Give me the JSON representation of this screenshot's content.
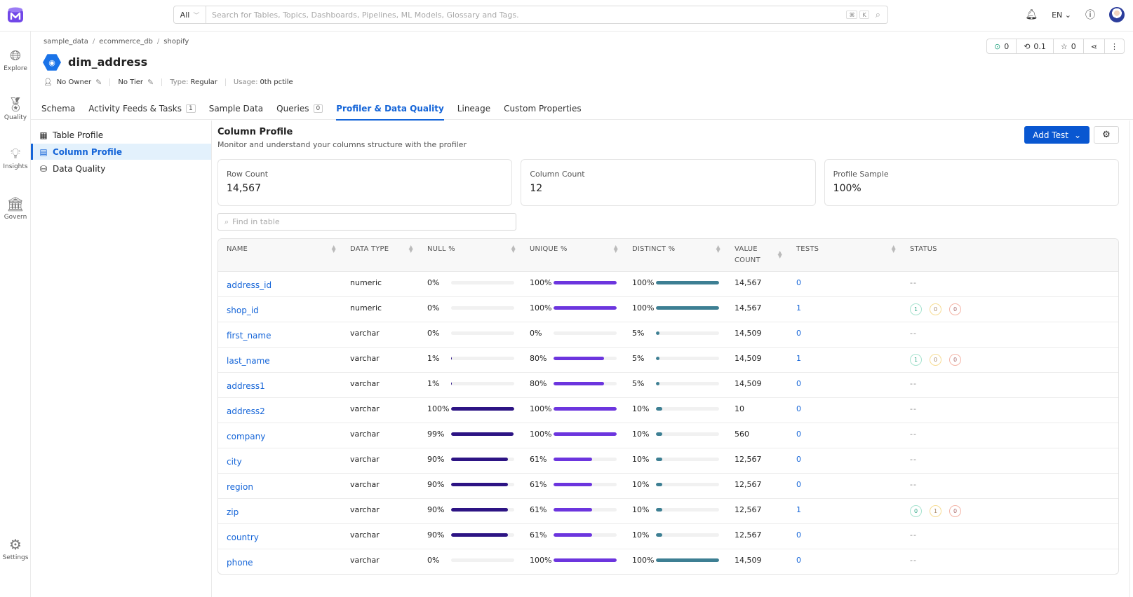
{
  "topbar": {
    "search_scope": "All",
    "search_placeholder": "Search for Tables, Topics, Dashboards, Pipelines, ML Models, Glossary and Tags.",
    "kbd_keys": [
      "⌘",
      "K"
    ],
    "language": "EN"
  },
  "leftnav": {
    "items": [
      {
        "label": "Explore",
        "icon": "globe-search-icon"
      },
      {
        "label": "Quality",
        "icon": "award-icon"
      },
      {
        "label": "Insights",
        "icon": "lightbulb-icon"
      },
      {
        "label": "Govern",
        "icon": "bank-icon"
      },
      {
        "label": "Settings",
        "icon": "sliders-icon"
      }
    ]
  },
  "breadcrumb": [
    "sample_data",
    "ecommerce_db",
    "shopify"
  ],
  "entity": {
    "title": "dim_address",
    "owner": "No Owner",
    "tier": "No Tier",
    "type_label": "Type:",
    "type_value": "Regular",
    "usage_label": "Usage:",
    "usage_value": "0th pctile"
  },
  "actions": {
    "followers": "0",
    "version": "0.1",
    "stars": "0"
  },
  "tabs": [
    {
      "label": "Schema"
    },
    {
      "label": "Activity Feeds & Tasks",
      "badge": "1"
    },
    {
      "label": "Sample Data"
    },
    {
      "label": "Queries",
      "badge": "0"
    },
    {
      "label": "Profiler & Data Quality",
      "active": true
    },
    {
      "label": "Lineage"
    },
    {
      "label": "Custom Properties"
    }
  ],
  "subnav": [
    {
      "label": "Table Profile",
      "active": false
    },
    {
      "label": "Column Profile",
      "active": true
    },
    {
      "label": "Data Quality",
      "active": false
    }
  ],
  "main": {
    "title": "Column Profile",
    "subtitle": "Monitor and understand your columns structure with the profiler",
    "add_test_label": "Add Test",
    "cards": [
      {
        "label": "Row Count",
        "value": "14,567"
      },
      {
        "label": "Column Count",
        "value": "12"
      },
      {
        "label": "Profile Sample",
        "value": "100%"
      }
    ],
    "find_placeholder": "Find in table"
  },
  "colors": {
    "accent": "#1565d8",
    "null_bar": "#2d1484",
    "unique_bar": "#6c35de",
    "distinct_bar": "#3d7f93"
  },
  "table": {
    "headers": [
      "NAME",
      "DATA TYPE",
      "NULL %",
      "UNIQUE %",
      "DISTINCT %",
      "VALUE COUNT",
      "TESTS",
      "STATUS"
    ],
    "rows": [
      {
        "name": "address_id",
        "type": "numeric",
        "null": 0,
        "unique": 100,
        "distinct": 100,
        "count": "14,567",
        "tests": "0",
        "status": null
      },
      {
        "name": "shop_id",
        "type": "numeric",
        "null": 0,
        "unique": 100,
        "distinct": 100,
        "count": "14,567",
        "tests": "1",
        "status": [
          "1",
          "0",
          "0"
        ]
      },
      {
        "name": "first_name",
        "type": "varchar",
        "null": 0,
        "unique": 0,
        "distinct": 5,
        "count": "14,509",
        "tests": "0",
        "status": null
      },
      {
        "name": "last_name",
        "type": "varchar",
        "null": 1,
        "unique": 80,
        "distinct": 5,
        "count": "14,509",
        "tests": "1",
        "status": [
          "1",
          "0",
          "0"
        ]
      },
      {
        "name": "address1",
        "type": "varchar",
        "null": 1,
        "unique": 80,
        "distinct": 5,
        "count": "14,509",
        "tests": "0",
        "status": null
      },
      {
        "name": "address2",
        "type": "varchar",
        "null": 100,
        "unique": 100,
        "distinct": 10,
        "count": "10",
        "tests": "0",
        "status": null
      },
      {
        "name": "company",
        "type": "varchar",
        "null": 99,
        "unique": 100,
        "distinct": 10,
        "count": "560",
        "tests": "0",
        "status": null
      },
      {
        "name": "city",
        "type": "varchar",
        "null": 90,
        "unique": 61,
        "distinct": 10,
        "count": "12,567",
        "tests": "0",
        "status": null
      },
      {
        "name": "region",
        "type": "varchar",
        "null": 90,
        "unique": 61,
        "distinct": 10,
        "count": "12,567",
        "tests": "0",
        "status": null
      },
      {
        "name": "zip",
        "type": "varchar",
        "null": 90,
        "unique": 61,
        "distinct": 10,
        "count": "12,567",
        "tests": "1",
        "status": [
          "0",
          "1",
          "0"
        ]
      },
      {
        "name": "country",
        "type": "varchar",
        "null": 90,
        "unique": 61,
        "distinct": 10,
        "count": "12,567",
        "tests": "0",
        "status": null
      },
      {
        "name": "phone",
        "type": "varchar",
        "null": 0,
        "unique": 100,
        "distinct": 100,
        "count": "14,509",
        "tests": "0",
        "status": null
      }
    ],
    "empty_status": "--"
  }
}
